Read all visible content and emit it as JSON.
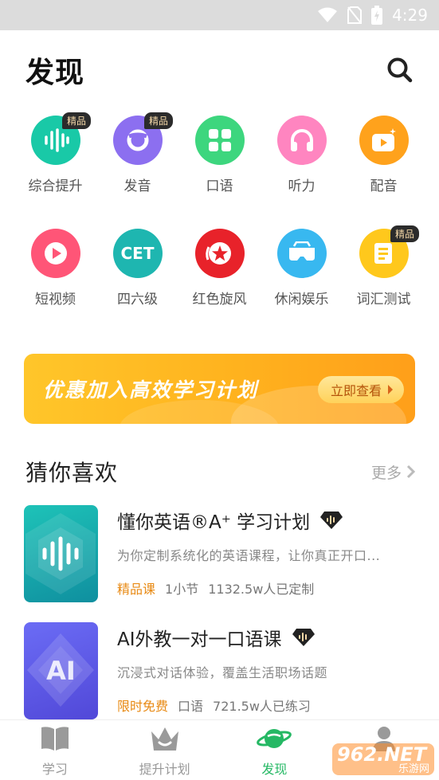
{
  "status_bar": {
    "time": "4:29"
  },
  "header": {
    "title": "发现"
  },
  "categories_row1": [
    {
      "label": "综合提升",
      "badge": "精品",
      "icon": "soundwave-icon",
      "color": "#19c9a7"
    },
    {
      "label": "发音",
      "badge": "精品",
      "icon": "pronunciation-icon",
      "color": "#8c6ff0"
    },
    {
      "label": "口语",
      "badge": "",
      "icon": "grid-icon",
      "color": "#3dd67e"
    },
    {
      "label": "听力",
      "badge": "",
      "icon": "headphones-icon",
      "color": "#ff85c0"
    },
    {
      "label": "配音",
      "badge": "",
      "icon": "dubbing-tv-icon",
      "color": "#ffa21c"
    }
  ],
  "categories_row2": [
    {
      "label": "短视频",
      "badge": "",
      "icon": "play-icon",
      "color": "#ff5577"
    },
    {
      "label": "四六级",
      "badge": "",
      "icon": "cet-icon",
      "color": "#1eb6b0",
      "icon_text": "CET"
    },
    {
      "label": "红色旋风",
      "badge": "",
      "icon": "red-star-icon",
      "color": "#e8222a"
    },
    {
      "label": "休闲娱乐",
      "badge": "",
      "icon": "vr-glasses-icon",
      "color": "#38b8f0"
    },
    {
      "label": "词汇测试",
      "badge": "精品",
      "icon": "vocab-test-icon",
      "color": "#ffc81c"
    }
  ],
  "banner": {
    "text": "优惠加入高效学习计划",
    "button_label": "立即查看"
  },
  "recommend": {
    "title": "猜你喜欢",
    "more_label": "更多"
  },
  "courses": [
    {
      "title": "懂你英语®A⁺ 学习计划",
      "desc": "为你定制系统化的英语课程，让你真正开口...",
      "tag": "精品课",
      "sections": "1小节",
      "count": "1132.5w人已定制",
      "thumb_icon": "soundwave-icon",
      "premium_icon": "diamond-icon"
    },
    {
      "title": "AI外教一对一口语课",
      "desc": "沉浸式对话体验，覆盖生活职场话题",
      "tag": "限时免费",
      "sections": "口语",
      "count": "721.5w人已练习",
      "thumb_text": "AI",
      "premium_icon": "diamond-icon"
    }
  ],
  "tabs": [
    {
      "label": "学习",
      "icon": "book-icon"
    },
    {
      "label": "提升计划",
      "icon": "crown-icon"
    },
    {
      "label": "发现",
      "icon": "planet-icon",
      "active": true
    },
    {
      "label": "",
      "icon": "profile-icon"
    }
  ],
  "watermark": {
    "text": "962.NET",
    "subtext": "乐游网"
  },
  "colors": {
    "accent_green": "#25b864",
    "tag_orange": "#e88a14",
    "banner": "#ffb21e"
  }
}
